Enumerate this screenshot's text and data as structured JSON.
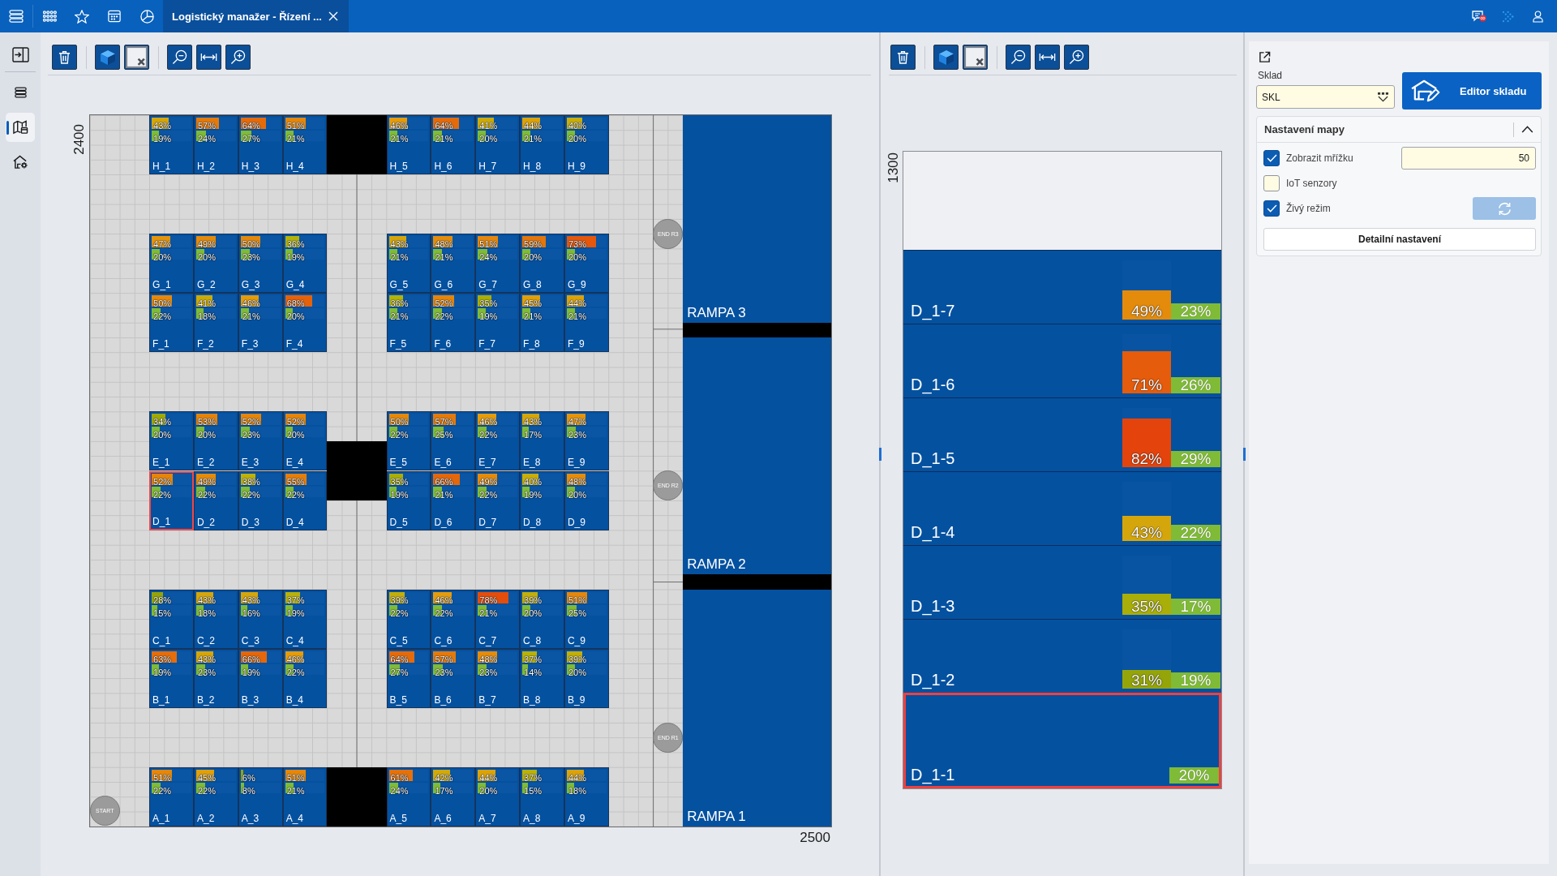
{
  "top_bar": {
    "tabs": [
      {
        "title": "Logistický manažer - Řízení ...",
        "selected": true
      }
    ]
  },
  "sidebar": {
    "items": [
      {
        "selected": false
      },
      {
        "selected": false
      },
      {
        "selected": true
      },
      {
        "selected": false
      }
    ]
  },
  "map": {
    "y_extent": "2400",
    "x_extent": "2500",
    "rows": [
      {
        "cells": [
          {
            "label": "H_1",
            "selected": false,
            "upper_bar": {
              "reading": "43%",
              "level": 0.43
            },
            "lower_bar": {
              "reading": "19%",
              "level": 0.19
            }
          },
          {
            "label": "H_2",
            "selected": false,
            "upper_bar": {
              "reading": "57%",
              "level": 0.57
            },
            "lower_bar": {
              "reading": "24%",
              "level": 0.24
            }
          },
          {
            "label": "H_3",
            "selected": false,
            "upper_bar": {
              "reading": "64%",
              "level": 0.64
            },
            "lower_bar": {
              "reading": "27%",
              "level": 0.27
            }
          },
          {
            "label": "H_4",
            "selected": false,
            "upper_bar": {
              "reading": "51%",
              "level": 0.51
            },
            "lower_bar": {
              "reading": "21%",
              "level": 0.21
            }
          },
          {
            "label": "H_5",
            "selected": false,
            "upper_bar": {
              "reading": "46%",
              "level": 0.46
            },
            "lower_bar": {
              "reading": "21%",
              "level": 0.21
            }
          },
          {
            "label": "H_6",
            "selected": false,
            "upper_bar": {
              "reading": "64%",
              "level": 0.64
            },
            "lower_bar": {
              "reading": "21%",
              "level": 0.21
            }
          },
          {
            "label": "H_7",
            "selected": false,
            "upper_bar": {
              "reading": "41%",
              "level": 0.41
            },
            "lower_bar": {
              "reading": "20%",
              "level": 0.2
            }
          },
          {
            "label": "H_8",
            "selected": false,
            "upper_bar": {
              "reading": "44%",
              "level": 0.44
            },
            "lower_bar": {
              "reading": "21%",
              "level": 0.21
            }
          },
          {
            "label": "H_9",
            "selected": false,
            "upper_bar": {
              "reading": "40%",
              "level": 0.4
            },
            "lower_bar": {
              "reading": "20%",
              "level": 0.2
            }
          }
        ]
      },
      {
        "cells": [
          {
            "label": "G_1",
            "selected": false,
            "upper_bar": {
              "reading": "47%",
              "level": 0.47
            },
            "lower_bar": {
              "reading": "20%",
              "level": 0.2
            }
          },
          {
            "label": "G_2",
            "selected": false,
            "upper_bar": {
              "reading": "49%",
              "level": 0.49
            },
            "lower_bar": {
              "reading": "20%",
              "level": 0.2
            }
          },
          {
            "label": "G_3",
            "selected": false,
            "upper_bar": {
              "reading": "50%",
              "level": 0.5
            },
            "lower_bar": {
              "reading": "23%",
              "level": 0.23
            }
          },
          {
            "label": "G_4",
            "selected": false,
            "upper_bar": {
              "reading": "36%",
              "level": 0.36
            },
            "lower_bar": {
              "reading": "19%",
              "level": 0.19
            }
          },
          {
            "label": "G_5",
            "selected": false,
            "upper_bar": {
              "reading": "43%",
              "level": 0.43
            },
            "lower_bar": {
              "reading": "21%",
              "level": 0.21
            }
          },
          {
            "label": "G_6",
            "selected": false,
            "upper_bar": {
              "reading": "48%",
              "level": 0.48
            },
            "lower_bar": {
              "reading": "21%",
              "level": 0.21
            }
          },
          {
            "label": "G_7",
            "selected": false,
            "upper_bar": {
              "reading": "51%",
              "level": 0.51
            },
            "lower_bar": {
              "reading": "24%",
              "level": 0.24
            }
          },
          {
            "label": "G_8",
            "selected": false,
            "upper_bar": {
              "reading": "59%",
              "level": 0.59
            },
            "lower_bar": {
              "reading": "20%",
              "level": 0.2
            }
          },
          {
            "label": "G_9",
            "selected": false,
            "upper_bar": {
              "reading": "73%",
              "level": 0.73
            },
            "lower_bar": {
              "reading": "20%",
              "level": 0.2
            }
          }
        ]
      },
      {
        "cells": [
          {
            "label": "F_1",
            "selected": false,
            "upper_bar": {
              "reading": "50%",
              "level": 0.5
            },
            "lower_bar": {
              "reading": "22%",
              "level": 0.22
            }
          },
          {
            "label": "F_2",
            "selected": false,
            "upper_bar": {
              "reading": "41%",
              "level": 0.41
            },
            "lower_bar": {
              "reading": "18%",
              "level": 0.18
            }
          },
          {
            "label": "F_3",
            "selected": false,
            "upper_bar": {
              "reading": "46%",
              "level": 0.46
            },
            "lower_bar": {
              "reading": "21%",
              "level": 0.21
            }
          },
          {
            "label": "F_4",
            "selected": false,
            "upper_bar": {
              "reading": "68%",
              "level": 0.68
            },
            "lower_bar": {
              "reading": "20%",
              "level": 0.2
            }
          },
          {
            "label": "F_5",
            "selected": false,
            "upper_bar": {
              "reading": "36%",
              "level": 0.36
            },
            "lower_bar": {
              "reading": "21%",
              "level": 0.21
            }
          },
          {
            "label": "F_6",
            "selected": false,
            "upper_bar": {
              "reading": "52%",
              "level": 0.52
            },
            "lower_bar": {
              "reading": "22%",
              "level": 0.22
            }
          },
          {
            "label": "F_7",
            "selected": false,
            "upper_bar": {
              "reading": "35%",
              "level": 0.35
            },
            "lower_bar": {
              "reading": "19%",
              "level": 0.19
            }
          },
          {
            "label": "F_8",
            "selected": false,
            "upper_bar": {
              "reading": "45%",
              "level": 0.45
            },
            "lower_bar": {
              "reading": "21%",
              "level": 0.21
            }
          },
          {
            "label": "F_9",
            "selected": false,
            "upper_bar": {
              "reading": "44%",
              "level": 0.44
            },
            "lower_bar": {
              "reading": "21%",
              "level": 0.21
            }
          }
        ]
      },
      {
        "cells": [
          {
            "label": "E_1",
            "selected": false,
            "upper_bar": {
              "reading": "34%",
              "level": 0.34
            },
            "lower_bar": {
              "reading": "20%",
              "level": 0.2
            }
          },
          {
            "label": "E_2",
            "selected": false,
            "upper_bar": {
              "reading": "53%",
              "level": 0.53
            },
            "lower_bar": {
              "reading": "20%",
              "level": 0.2
            }
          },
          {
            "label": "E_3",
            "selected": false,
            "upper_bar": {
              "reading": "52%",
              "level": 0.52
            },
            "lower_bar": {
              "reading": "23%",
              "level": 0.23
            }
          },
          {
            "label": "E_4",
            "selected": false,
            "upper_bar": {
              "reading": "52%",
              "level": 0.52
            },
            "lower_bar": {
              "reading": "20%",
              "level": 0.2
            }
          },
          {
            "label": "E_5",
            "selected": false,
            "upper_bar": {
              "reading": "50%",
              "level": 0.5
            },
            "lower_bar": {
              "reading": "22%",
              "level": 0.22
            }
          },
          {
            "label": "E_6",
            "selected": false,
            "upper_bar": {
              "reading": "57%",
              "level": 0.57
            },
            "lower_bar": {
              "reading": "25%",
              "level": 0.25
            }
          },
          {
            "label": "E_7",
            "selected": false,
            "upper_bar": {
              "reading": "46%",
              "level": 0.46
            },
            "lower_bar": {
              "reading": "22%",
              "level": 0.22
            }
          },
          {
            "label": "E_8",
            "selected": false,
            "upper_bar": {
              "reading": "43%",
              "level": 0.43
            },
            "lower_bar": {
              "reading": "17%",
              "level": 0.17
            }
          },
          {
            "label": "E_9",
            "selected": false,
            "upper_bar": {
              "reading": "47%",
              "level": 0.47
            },
            "lower_bar": {
              "reading": "23%",
              "level": 0.23
            }
          }
        ]
      },
      {
        "cells": [
          {
            "label": "D_1",
            "selected": true,
            "upper_bar": {
              "reading": "52%",
              "level": 0.52
            },
            "lower_bar": {
              "reading": "22%",
              "level": 0.22
            }
          },
          {
            "label": "D_2",
            "selected": false,
            "upper_bar": {
              "reading": "49%",
              "level": 0.49
            },
            "lower_bar": {
              "reading": "22%",
              "level": 0.22
            }
          },
          {
            "label": "D_3",
            "selected": false,
            "upper_bar": {
              "reading": "38%",
              "level": 0.38
            },
            "lower_bar": {
              "reading": "22%",
              "level": 0.22
            }
          },
          {
            "label": "D_4",
            "selected": false,
            "upper_bar": {
              "reading": "55%",
              "level": 0.55
            },
            "lower_bar": {
              "reading": "22%",
              "level": 0.22
            }
          },
          {
            "label": "D_5",
            "selected": false,
            "upper_bar": {
              "reading": "35%",
              "level": 0.35
            },
            "lower_bar": {
              "reading": "19%",
              "level": 0.19
            }
          },
          {
            "label": "D_6",
            "selected": false,
            "upper_bar": {
              "reading": "66%",
              "level": 0.66
            },
            "lower_bar": {
              "reading": "21%",
              "level": 0.21
            }
          },
          {
            "label": "D_7",
            "selected": false,
            "upper_bar": {
              "reading": "49%",
              "level": 0.49
            },
            "lower_bar": {
              "reading": "22%",
              "level": 0.22
            }
          },
          {
            "label": "D_8",
            "selected": false,
            "upper_bar": {
              "reading": "40%",
              "level": 0.4
            },
            "lower_bar": {
              "reading": "19%",
              "level": 0.19
            }
          },
          {
            "label": "D_9",
            "selected": false,
            "upper_bar": {
              "reading": "48%",
              "level": 0.48
            },
            "lower_bar": {
              "reading": "20%",
              "level": 0.2
            }
          }
        ]
      },
      {
        "cells": [
          {
            "label": "C_1",
            "selected": false,
            "upper_bar": {
              "reading": "28%",
              "level": 0.28
            },
            "lower_bar": {
              "reading": "15%",
              "level": 0.15
            }
          },
          {
            "label": "C_2",
            "selected": false,
            "upper_bar": {
              "reading": "43%",
              "level": 0.43
            },
            "lower_bar": {
              "reading": "18%",
              "level": 0.18
            }
          },
          {
            "label": "C_3",
            "selected": false,
            "upper_bar": {
              "reading": "43%",
              "level": 0.43
            },
            "lower_bar": {
              "reading": "16%",
              "level": 0.16
            }
          },
          {
            "label": "C_4",
            "selected": false,
            "upper_bar": {
              "reading": "37%",
              "level": 0.37
            },
            "lower_bar": {
              "reading": "19%",
              "level": 0.19
            }
          },
          {
            "label": "C_5",
            "selected": false,
            "upper_bar": {
              "reading": "39%",
              "level": 0.39
            },
            "lower_bar": {
              "reading": "22%",
              "level": 0.22
            }
          },
          {
            "label": "C_6",
            "selected": false,
            "upper_bar": {
              "reading": "46%",
              "level": 0.46
            },
            "lower_bar": {
              "reading": "22%",
              "level": 0.22
            }
          },
          {
            "label": "C_7",
            "selected": false,
            "upper_bar": {
              "reading": "78%",
              "level": 0.78
            },
            "lower_bar": {
              "reading": "21%",
              "level": 0.21
            }
          },
          {
            "label": "C_8",
            "selected": false,
            "upper_bar": {
              "reading": "39%",
              "level": 0.39
            },
            "lower_bar": {
              "reading": "20%",
              "level": 0.2
            }
          },
          {
            "label": "C_9",
            "selected": false,
            "upper_bar": {
              "reading": "51%",
              "level": 0.51
            },
            "lower_bar": {
              "reading": "25%",
              "level": 0.25
            }
          }
        ]
      },
      {
        "cells": [
          {
            "label": "B_1",
            "selected": false,
            "upper_bar": {
              "reading": "63%",
              "level": 0.63
            },
            "lower_bar": {
              "reading": "19%",
              "level": 0.19
            }
          },
          {
            "label": "B_2",
            "selected": false,
            "upper_bar": {
              "reading": "43%",
              "level": 0.43
            },
            "lower_bar": {
              "reading": "23%",
              "level": 0.23
            }
          },
          {
            "label": "B_3",
            "selected": false,
            "upper_bar": {
              "reading": "66%",
              "level": 0.66
            },
            "lower_bar": {
              "reading": "19%",
              "level": 0.19
            }
          },
          {
            "label": "B_4",
            "selected": false,
            "upper_bar": {
              "reading": "46%",
              "level": 0.46
            },
            "lower_bar": {
              "reading": "22%",
              "level": 0.22
            }
          },
          {
            "label": "B_5",
            "selected": false,
            "upper_bar": {
              "reading": "64%",
              "level": 0.64
            },
            "lower_bar": {
              "reading": "27%",
              "level": 0.27
            }
          },
          {
            "label": "B_6",
            "selected": false,
            "upper_bar": {
              "reading": "57%",
              "level": 0.57
            },
            "lower_bar": {
              "reading": "23%",
              "level": 0.23
            }
          },
          {
            "label": "B_7",
            "selected": false,
            "upper_bar": {
              "reading": "48%",
              "level": 0.48
            },
            "lower_bar": {
              "reading": "23%",
              "level": 0.23
            }
          },
          {
            "label": "B_8",
            "selected": false,
            "upper_bar": {
              "reading": "37%",
              "level": 0.37
            },
            "lower_bar": {
              "reading": "14%",
              "level": 0.14
            }
          },
          {
            "label": "B_9",
            "selected": false,
            "upper_bar": {
              "reading": "39%",
              "level": 0.39
            },
            "lower_bar": {
              "reading": "20%",
              "level": 0.2
            }
          }
        ]
      },
      {
        "cells": [
          {
            "label": "A_1",
            "selected": false,
            "upper_bar": {
              "reading": "51%",
              "level": 0.51
            },
            "lower_bar": {
              "reading": "22%",
              "level": 0.22
            }
          },
          {
            "label": "A_2",
            "selected": false,
            "upper_bar": {
              "reading": "45%",
              "level": 0.45
            },
            "lower_bar": {
              "reading": "22%",
              "level": 0.22
            }
          },
          {
            "label": "A_3",
            "selected": false,
            "upper_bar": {
              "reading": "6%",
              "level": 0.06
            },
            "lower_bar": {
              "reading": "8%",
              "level": 0.08
            }
          },
          {
            "label": "A_4",
            "selected": false,
            "upper_bar": {
              "reading": "51%",
              "level": 0.51
            },
            "lower_bar": {
              "reading": "21%",
              "level": 0.21
            }
          },
          {
            "label": "A_5",
            "selected": false,
            "upper_bar": {
              "reading": "61%",
              "level": 0.61
            },
            "lower_bar": {
              "reading": "24%",
              "level": 0.24
            }
          },
          {
            "label": "A_6",
            "selected": false,
            "upper_bar": {
              "reading": "42%",
              "level": 0.42
            },
            "lower_bar": {
              "reading": "17%",
              "level": 0.17
            }
          },
          {
            "label": "A_7",
            "selected": false,
            "upper_bar": {
              "reading": "44%",
              "level": 0.44
            },
            "lower_bar": {
              "reading": "20%",
              "level": 0.2
            }
          },
          {
            "label": "A_8",
            "selected": false,
            "upper_bar": {
              "reading": "37%",
              "level": 0.37
            },
            "lower_bar": {
              "reading": "15%",
              "level": 0.15
            }
          },
          {
            "label": "A_9",
            "selected": false,
            "upper_bar": {
              "reading": "44%",
              "level": 0.44
            },
            "lower_bar": {
              "reading": "18%",
              "level": 0.18
            }
          }
        ]
      }
    ],
    "ramps": [
      {
        "label": "RAMPA 3"
      },
      {
        "label": "RAMPA 2"
      },
      {
        "label": "RAMPA 1"
      }
    ],
    "markers": [
      {
        "label": "END R3"
      },
      {
        "label": "END R2"
      },
      {
        "label": "END R1"
      },
      {
        "label": "START"
      }
    ]
  },
  "detail": {
    "height_label": "1300",
    "slots": [
      {
        "label": "D_1-7",
        "selected": false,
        "upper_bar": {
          "reading": "49%",
          "level": 0.49
        },
        "lower_bar": {
          "reading": "23%"
        }
      },
      {
        "label": "D_1-6",
        "selected": false,
        "upper_bar": {
          "reading": "71%",
          "level": 0.71
        },
        "lower_bar": {
          "reading": "26%"
        }
      },
      {
        "label": "D_1-5",
        "selected": false,
        "upper_bar": {
          "reading": "82%",
          "level": 0.82
        },
        "lower_bar": {
          "reading": "29%"
        }
      },
      {
        "label": "D_1-4",
        "selected": false,
        "upper_bar": {
          "reading": "43%",
          "level": 0.43
        },
        "lower_bar": {
          "reading": "22%"
        }
      },
      {
        "label": "D_1-3",
        "selected": false,
        "upper_bar": {
          "reading": "35%",
          "level": 0.35
        },
        "lower_bar": {
          "reading": "17%"
        }
      },
      {
        "label": "D_1-2",
        "selected": false,
        "upper_bar": {
          "reading": "31%",
          "level": 0.31
        },
        "lower_bar": {
          "reading": "19%"
        }
      },
      {
        "label": "D_1-1",
        "selected": true,
        "lower_bar": {
          "reading": "20%"
        }
      }
    ]
  },
  "settings": {
    "warehouse": {
      "label": "Sklad",
      "value": "SKL"
    },
    "editor_button": "Editor skladu",
    "map_section": {
      "title": "Nastavení mapy",
      "expanded": true,
      "options": [
        {
          "kind": "field",
          "label": "Zobrazit mřížku",
          "checked": true,
          "value": "50"
        },
        {
          "kind": "plain",
          "label": "IoT senzory",
          "checked": false
        },
        {
          "kind": "action",
          "label": "Živý režim",
          "checked": true,
          "disabled": true
        }
      ],
      "detail_button": "Detailní nastavení"
    }
  }
}
